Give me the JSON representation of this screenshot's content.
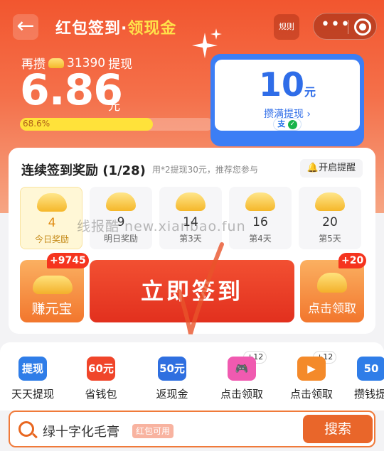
{
  "header": {
    "back_icon": "arrow-left-icon",
    "title_main": "红包签到·",
    "title_highlight": "领现金",
    "rules_label": "规则",
    "more_icon": "more-dots-icon",
    "close_icon": "target-circle-icon"
  },
  "balance": {
    "save_prefix": "再攒",
    "save_amount": "31390",
    "save_suffix": "提现",
    "amount": "6.86",
    "unit": "元",
    "progress_text": "68.6%",
    "progress_fraction": 0.686
  },
  "withdraw_card": {
    "amount": "10",
    "unit": "元",
    "link": "攒满提现 ›",
    "alipay_label": "支",
    "wechat_label": "✓"
  },
  "checkin": {
    "title": "连续签到奖励 (1/28)",
    "subtitle": "用*2提现30元，推荐您参与",
    "remind_label": "开启提醒",
    "days": [
      {
        "value": "4",
        "label": "今日奖励"
      },
      {
        "value": "9",
        "label": "明日奖励"
      },
      {
        "value": "14",
        "label": "第3天"
      },
      {
        "value": "16",
        "label": "第4天"
      },
      {
        "value": "20",
        "label": "第5天"
      }
    ],
    "watermark": "线报酷 new.xianbao.fun"
  },
  "actions": {
    "earn_badge": "+9745",
    "earn_label": "赚元宝",
    "signin_label": "立即签到",
    "claim_badge": "+20",
    "claim_label": "点击领取"
  },
  "tools": [
    {
      "icon_text": "提现",
      "label": "天天提现",
      "color": "#2f7de8",
      "plus": ""
    },
    {
      "icon_text": "60元",
      "label": "省钱包",
      "color": "#f0452a",
      "plus": ""
    },
    {
      "icon_text": "50元",
      "label": "返现金",
      "color": "#2f6fe0",
      "plus": ""
    },
    {
      "icon_text": "🎮",
      "label": "点击领取",
      "color": "#f05ab0",
      "plus": "+12"
    },
    {
      "icon_text": "▶",
      "label": "点击领取",
      "color": "#f48a2a",
      "plus": "+12"
    },
    {
      "icon_text": "50",
      "label": "攒钱提",
      "color": "#2f7de8",
      "plus": ""
    }
  ],
  "search": {
    "query": "绿十字化毛膏",
    "tag": "红包可用",
    "button": "搜索"
  }
}
